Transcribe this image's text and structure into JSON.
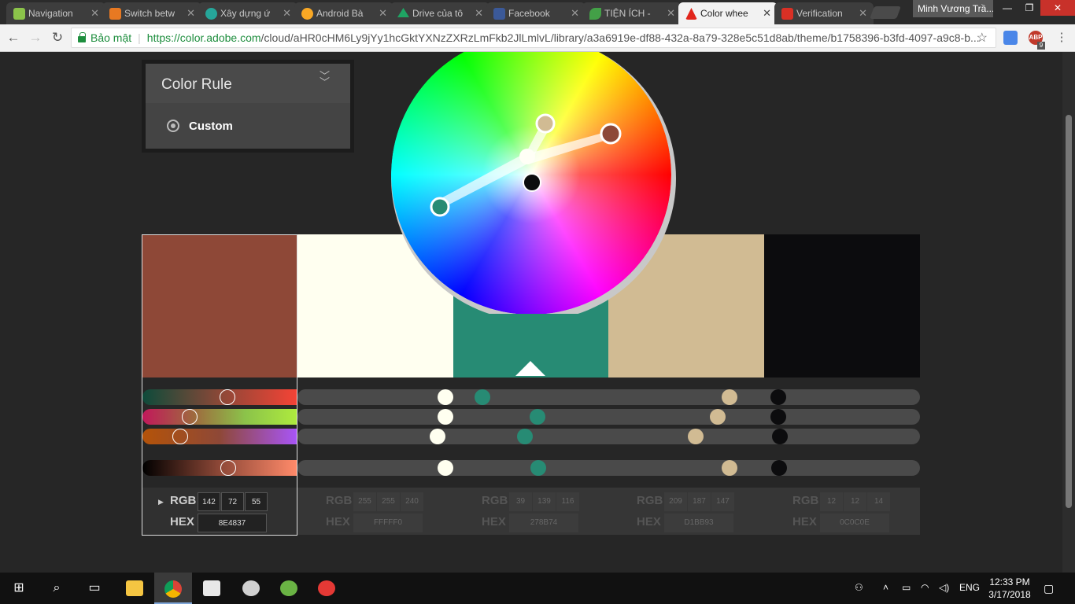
{
  "browser": {
    "tabs": [
      {
        "title": "Navigation",
        "favicon": "android-icon",
        "color": "#8bc34a"
      },
      {
        "title": "Switch betw",
        "favicon": "stackoverflow-icon",
        "color": "#e87922"
      },
      {
        "title": "Xây dựng ứ",
        "favicon": "globe-icon",
        "color": "#26a69a"
      },
      {
        "title": "Android Bà",
        "favicon": "android-badge-icon",
        "color": "#f9a825"
      },
      {
        "title": "Drive của tô",
        "favicon": "google-drive-icon",
        "color": "#1fa463"
      },
      {
        "title": "Facebook",
        "favicon": "facebook-icon",
        "color": "#3b5998"
      },
      {
        "title": "TIỆN ÍCH -",
        "favicon": "leaf-icon",
        "color": "#43a047"
      },
      {
        "title": "Color whee",
        "favicon": "adobe-icon",
        "color": "#e1251b"
      },
      {
        "title": "Verification",
        "favicon": "gmail-icon",
        "color": "#d93025"
      }
    ],
    "profile_name": "Minh Vương Trầ...",
    "security_label": "Bảo mật",
    "url_prefix": "https://color.adobe.com",
    "url_rest": "/cloud/aHR0cHM6Ly9jYy1hcGktYXNzZXRzLmFkb2JlLmlvL/library/a3a6919e-df88-432a-8a79-328e5c51d8ab/theme/b1758396-b3fd-4097-a9c8-b...",
    "abp_count": "9"
  },
  "color_rule": {
    "title": "Color Rule",
    "selected": "Custom"
  },
  "swatches": [
    {
      "hex": "#8E4837",
      "rgb": [
        "142",
        "72",
        "55"
      ],
      "hex_label": "8E4837"
    },
    {
      "hex": "#FFFFF0",
      "rgb": [
        "255",
        "255",
        "240"
      ],
      "hex_label": "FFFFF0"
    },
    {
      "hex": "#278B74",
      "rgb": [
        "39",
        "139",
        "116"
      ],
      "hex_label": "278B74"
    },
    {
      "hex": "#D1BB93",
      "rgb": [
        "209",
        "187",
        "147"
      ],
      "hex_label": "D1BB93"
    },
    {
      "hex": "#0C0C0E",
      "rgb": [
        "12",
        "12",
        "14"
      ],
      "hex_label": "0C0C0E"
    }
  ],
  "selected_swatch_index": 0,
  "labels": {
    "rgb": "RGB",
    "hex": "HEX"
  },
  "taskbar": {
    "time": "12:33 PM",
    "date": "3/17/2018",
    "language": "ENG"
  }
}
